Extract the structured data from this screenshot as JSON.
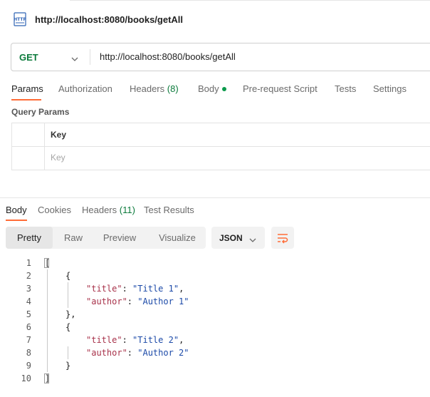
{
  "request": {
    "title": "http://localhost:8080/books/getAll",
    "icon": "http-file-icon",
    "method": "GET",
    "url": "http://localhost:8080/books/getAll"
  },
  "request_tabs": {
    "params": "Params",
    "authorization": "Authorization",
    "headers": "Headers",
    "headers_count": "(8)",
    "body": "Body",
    "prerequest": "Pre-request Script",
    "tests": "Tests",
    "settings": "Settings"
  },
  "query_params": {
    "title": "Query Params",
    "key_header": "Key",
    "key_placeholder": "Key"
  },
  "response_tabs": {
    "body": "Body",
    "cookies": "Cookies",
    "headers": "Headers",
    "headers_count": "(11)",
    "test_results": "Test Results"
  },
  "view_modes": {
    "pretty": "Pretty",
    "raw": "Raw",
    "preview": "Preview",
    "visualize": "Visualize"
  },
  "format": "JSON",
  "code": {
    "line_numbers": [
      "1",
      "2",
      "3",
      "4",
      "5",
      "6",
      "7",
      "8",
      "9",
      "10"
    ],
    "lines": [
      {
        "indent": 0,
        "parts": [
          [
            "punct",
            "["
          ]
        ]
      },
      {
        "indent": 1,
        "parts": [
          [
            "punct",
            "{"
          ]
        ]
      },
      {
        "indent": 2,
        "parts": [
          [
            "key",
            "\"title\""
          ],
          [
            "punct",
            ": "
          ],
          [
            "str",
            "\"Title 1\""
          ],
          [
            "punct",
            ","
          ]
        ]
      },
      {
        "indent": 2,
        "parts": [
          [
            "key",
            "\"author\""
          ],
          [
            "punct",
            ": "
          ],
          [
            "str",
            "\"Author 1\""
          ]
        ]
      },
      {
        "indent": 1,
        "parts": [
          [
            "punct",
            "},"
          ]
        ]
      },
      {
        "indent": 1,
        "parts": [
          [
            "punct",
            "{"
          ]
        ]
      },
      {
        "indent": 2,
        "parts": [
          [
            "key",
            "\"title\""
          ],
          [
            "punct",
            ": "
          ],
          [
            "str",
            "\"Title 2\""
          ],
          [
            "punct",
            ","
          ]
        ]
      },
      {
        "indent": 2,
        "parts": [
          [
            "key",
            "\"author\""
          ],
          [
            "punct",
            ": "
          ],
          [
            "str",
            "\"Author 2\""
          ]
        ]
      },
      {
        "indent": 1,
        "parts": [
          [
            "punct",
            "}"
          ]
        ]
      },
      {
        "indent": 0,
        "parts": [
          [
            "punct",
            "]"
          ]
        ]
      }
    ]
  },
  "colors": {
    "accent": "#ff6c37",
    "method_get": "#0b7a3b",
    "json_key": "#a8324a",
    "json_string": "#1c4aa8"
  }
}
